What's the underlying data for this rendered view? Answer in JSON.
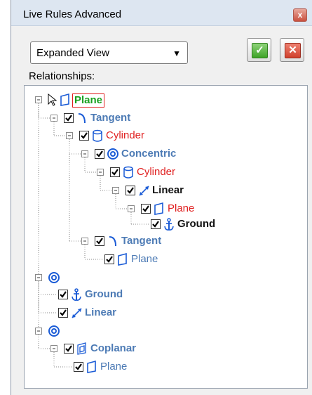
{
  "window": {
    "title": "Live Rules Advanced",
    "close_glyph": "x"
  },
  "toolbar": {
    "view_select_value": "Expanded View",
    "ok_glyph": "✓",
    "cancel_glyph": "✕"
  },
  "relationships_label": "Relationships:",
  "colors": {
    "relation_blue": "#4d7bb5",
    "red": "#e02020",
    "green": "#18a01e",
    "dark": "#111111",
    "face_blue": "#1a5bd6"
  },
  "tree": [
    {
      "key": "root-plane",
      "label": "Plane",
      "depth": 0,
      "icon": "plane-icon",
      "checkbox": false,
      "cursor": true,
      "color": "green",
      "bold": true,
      "boxed": true
    },
    {
      "key": "tangent-1",
      "label": "Tangent",
      "depth": 1,
      "icon": "tangent-icon",
      "checkbox": true,
      "color": "relation_blue",
      "bold": true
    },
    {
      "key": "cylinder-1",
      "label": "Cylinder",
      "depth": 2,
      "icon": "cylinder-icon",
      "checkbox": true,
      "color": "red",
      "bold": false
    },
    {
      "key": "concentric-1",
      "label": "Concentric",
      "depth": 3,
      "icon": "concentric-icon",
      "checkbox": true,
      "color": "relation_blue",
      "bold": true
    },
    {
      "key": "cylinder-2",
      "label": "Cylinder",
      "depth": 4,
      "icon": "cylinder-icon",
      "checkbox": true,
      "color": "red",
      "bold": false
    },
    {
      "key": "linear-1",
      "label": "Linear",
      "depth": 5,
      "icon": "linear-icon",
      "checkbox": true,
      "color": "dark",
      "bold": true
    },
    {
      "key": "plane-1",
      "label": "Plane",
      "depth": 6,
      "icon": "plane-icon",
      "checkbox": true,
      "color": "red",
      "bold": false
    },
    {
      "key": "ground-1",
      "label": "Ground",
      "depth": 7,
      "icon": "ground-anchor-icon",
      "checkbox": true,
      "color": "dark",
      "bold": true
    },
    {
      "key": "tangent-2",
      "label": "Tangent",
      "depth": 3,
      "icon": "tangent-icon",
      "checkbox": true,
      "color": "relation_blue",
      "bold": true
    },
    {
      "key": "plane-2",
      "label": "Plane",
      "depth": 4,
      "icon": "plane-icon",
      "checkbox": true,
      "color": "relation_blue",
      "bold": false
    },
    {
      "key": "concentric-2",
      "label": "",
      "depth": 0,
      "icon": "concentric-icon",
      "checkbox": false,
      "color": "relation_blue",
      "bold": true
    },
    {
      "key": "ground-2",
      "label": "Ground",
      "depth": 1,
      "icon": "ground-anchor-icon",
      "checkbox": true,
      "color": "relation_blue",
      "bold": true
    },
    {
      "key": "linear-2",
      "label": "Linear",
      "depth": 1,
      "icon": "linear-icon",
      "checkbox": true,
      "color": "relation_blue",
      "bold": true
    },
    {
      "key": "concentric-3",
      "label": "",
      "depth": 0,
      "icon": "concentric-icon",
      "checkbox": false,
      "color": "relation_blue",
      "bold": true
    },
    {
      "key": "coplanar-1",
      "label": "Coplanar",
      "depth": 1,
      "icon": "coplanar-icon",
      "checkbox": true,
      "color": "relation_blue",
      "bold": true
    },
    {
      "key": "plane-3",
      "label": "Plane",
      "depth": 2,
      "icon": "plane-icon",
      "checkbox": true,
      "color": "relation_blue",
      "bold": false
    }
  ]
}
